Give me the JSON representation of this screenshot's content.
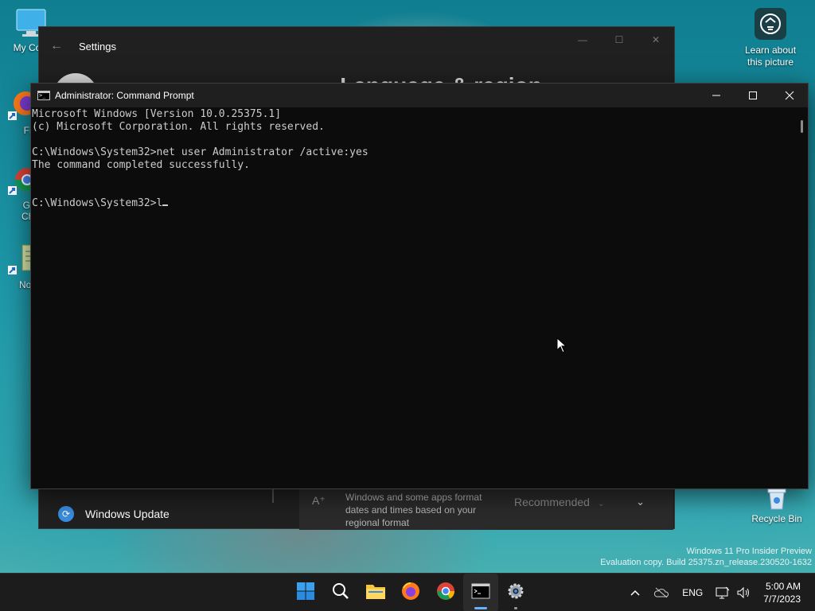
{
  "desktop": {
    "icons": [
      {
        "label": "My Com",
        "icon": "computer-icon"
      },
      {
        "label": "Fire",
        "icon": "firefox-icon"
      },
      {
        "label": "Goo",
        "label2": "Chro",
        "icon": "chrome-icon"
      },
      {
        "label": "Notep",
        "icon": "notepad-icon"
      }
    ],
    "learn_picture": {
      "line1": "Learn about",
      "line2": "this picture"
    },
    "recycle_bin": "Recycle Bin",
    "watermark": {
      "line1": "Windows 11 Pro Insider Preview",
      "line2": "Evaluation copy. Build 25375.zn_release.230520-1632"
    }
  },
  "settings": {
    "title": "Settings",
    "heading": "... › Language & region",
    "nav_update": "Windows Update",
    "region_desc": "Windows and some apps format dates and times based on your regional format",
    "region_select": "Recommended"
  },
  "cmd": {
    "title": "Administrator: Command Prompt",
    "lines": [
      "Microsoft Windows [Version 10.0.25375.1]",
      "(c) Microsoft Corporation. All rights reserved.",
      "",
      "C:\\Windows\\System32>net user Administrator /active:yes",
      "The command completed successfully.",
      "",
      ""
    ],
    "prompt": "C:\\Windows\\System32>l"
  },
  "taskbar": {
    "apps": [
      "start-icon",
      "search-icon",
      "file-explorer-icon",
      "firefox-icon",
      "chrome-icon",
      "terminal-icon",
      "settings-icon"
    ],
    "tray": {
      "language": "ENG",
      "time": "5:00 AM",
      "date": "7/7/2023"
    }
  },
  "colors": {
    "accent": "#66b3ff",
    "console_bg": "#0c0c0c",
    "console_fg": "#cccccc",
    "taskbar_bg": "#1c1c1c"
  }
}
